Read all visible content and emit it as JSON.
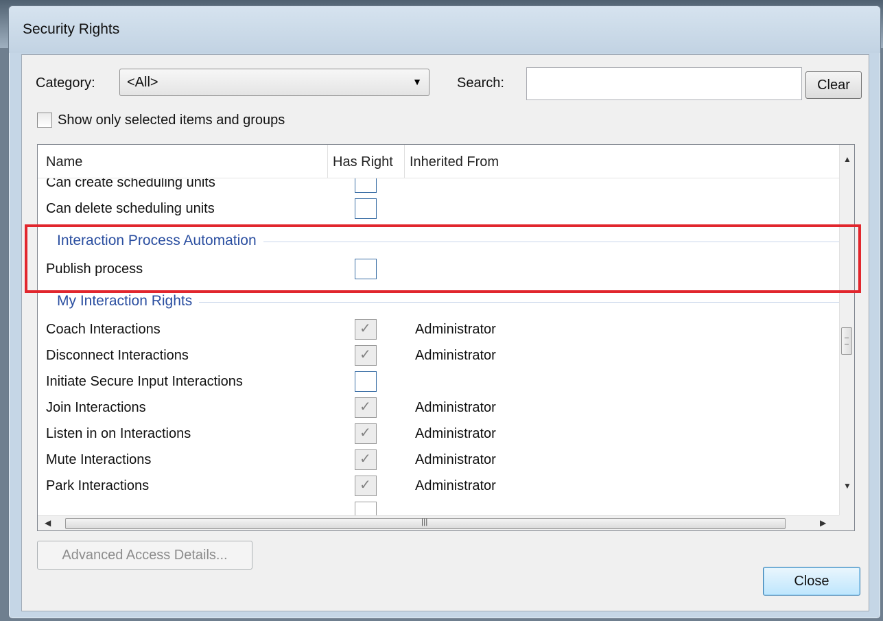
{
  "window": {
    "title": "Security Rights"
  },
  "filters": {
    "category_label": "Category:",
    "category_value": "<All>",
    "search_label": "Search:",
    "search_value": "",
    "clear_label": "Clear",
    "show_only_selected_label": "Show only selected items and groups",
    "show_only_selected_checked": false
  },
  "grid": {
    "columns": [
      "Name",
      "Has Right",
      "Inherited From"
    ],
    "rows_before": [
      {
        "name": "Can create scheduling units",
        "has_right": false,
        "inherited": ""
      },
      {
        "name": "Can delete scheduling units",
        "has_right": false,
        "inherited": ""
      }
    ],
    "group_ipa": "Interaction Process Automation",
    "ipa_rows": [
      {
        "name": "Publish process",
        "has_right": false,
        "inherited": ""
      }
    ],
    "group_my": "My Interaction Rights",
    "my_rows": [
      {
        "name": "Coach Interactions",
        "has_right": true,
        "inherited": "Administrator"
      },
      {
        "name": "Disconnect Interactions",
        "has_right": true,
        "inherited": "Administrator"
      },
      {
        "name": "Initiate Secure Input Interactions",
        "has_right": false,
        "inherited": ""
      },
      {
        "name": "Join Interactions",
        "has_right": true,
        "inherited": "Administrator"
      },
      {
        "name": "Listen in on Interactions",
        "has_right": true,
        "inherited": "Administrator"
      },
      {
        "name": "Mute Interactions",
        "has_right": true,
        "inherited": "Administrator"
      },
      {
        "name": "Park Interactions",
        "has_right": true,
        "inherited": "Administrator"
      }
    ]
  },
  "buttons": {
    "advanced_label": "Advanced Access Details...",
    "close_label": "Close"
  },
  "colors": {
    "highlight": "#e1262d",
    "group_text": "#2a4ea0"
  }
}
